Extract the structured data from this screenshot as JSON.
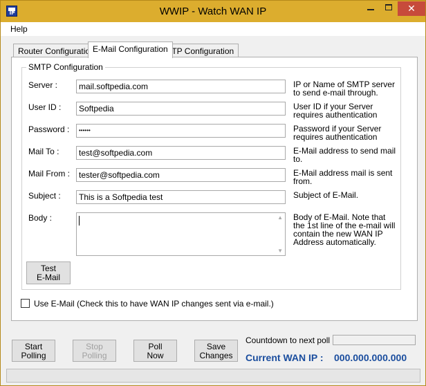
{
  "window": {
    "title": "WWIP - Watch WAN IP",
    "icon_text": "IP",
    "close_glyph": "✕"
  },
  "menu": {
    "help": "Help"
  },
  "tabs": [
    {
      "label": "Router Configuration",
      "active": false
    },
    {
      "label": "E-Mail Configuration",
      "active": true
    },
    {
      "label": "FTP Configuration",
      "active": false
    }
  ],
  "smtp": {
    "group_label": "SMTP Configuration",
    "fields": {
      "server": {
        "label": "Server :",
        "value": "mail.softpedia.com",
        "help": "IP or Name of SMTP server to send e-mail through."
      },
      "user_id": {
        "label": "User ID :",
        "value": "Softpedia",
        "help": "User ID if your Server requires authentication"
      },
      "password": {
        "label": "Password :",
        "value": "••••••",
        "help": "Password if your Server requires authentication"
      },
      "mail_to": {
        "label": "Mail To :",
        "value": "test@softpedia.com",
        "help": "E-Mail address to send mail to."
      },
      "mail_from": {
        "label": "Mail From :",
        "value": "tester@softpedia.com",
        "help": "E-Mail address mail is sent from."
      },
      "subject": {
        "label": "Subject :",
        "value": "This is a Softpedia test",
        "help": "Subject of E-Mail."
      },
      "body": {
        "label": "Body :",
        "value": "",
        "help": "Body of E-Mail. Note that the 1st line of the e-mail will contain the new WAN IP Address automatically."
      }
    },
    "test_button_line1": "Test",
    "test_button_line2": "E-Mail"
  },
  "use_email": {
    "checked": false,
    "label": "Use E-Mail (Check this to have WAN IP changes sent via e-mail.)"
  },
  "buttons": {
    "start_line1": "Start",
    "start_line2": "Polling",
    "stop_line1": "Stop",
    "stop_line2": "Polling",
    "poll_line1": "Poll",
    "poll_line2": "Now",
    "save_line1": "Save",
    "save_line2": "Changes"
  },
  "status": {
    "countdown_label": "Countdown to next poll :",
    "current_wan_label": "Current WAN IP :",
    "current_wan_value": "000.000.000.000"
  },
  "colors": {
    "titlebar": "#dcad2e",
    "close_button": "#c74b3b",
    "wan_ip_text": "#1a4d9e"
  }
}
